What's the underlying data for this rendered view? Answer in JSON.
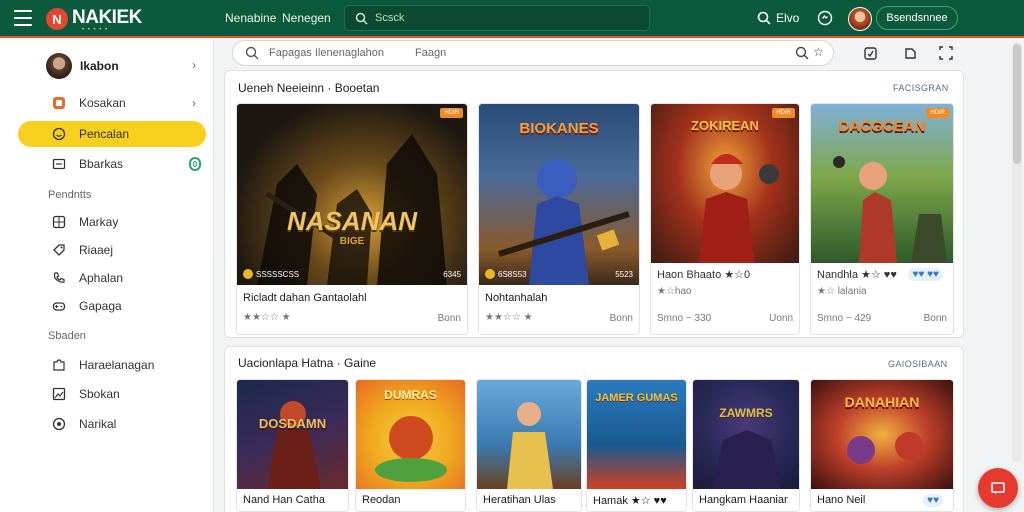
{
  "header": {
    "logo_letter": "N",
    "logo_text": "NAKIEK",
    "logo_sub": "• • • • •",
    "nav": [
      "Nenabine",
      "Nenegen"
    ],
    "search_placeholder": "Scsck",
    "right_label": "Elvo",
    "user_button": "Bsendsnnee"
  },
  "sidebar": {
    "profile_name": "Ikabon",
    "items_top": [
      {
        "label": "Kosakan",
        "icon": "orange-square-icon"
      },
      {
        "label": "Pencalan",
        "icon": "smile-icon"
      },
      {
        "label": "Bbarkas",
        "icon": "card-icon",
        "badge": "0"
      }
    ],
    "section1": "Pendntts",
    "items_mid": [
      {
        "label": "Markay",
        "icon": "grid-icon"
      },
      {
        "label": "Riaaej",
        "icon": "tag-icon"
      },
      {
        "label": "Aphalan",
        "icon": "phone-icon"
      },
      {
        "label": "Gapaga",
        "icon": "gamepad-icon"
      }
    ],
    "section2": "Sbaden",
    "items_bottom": [
      {
        "label": "Haraelanagan",
        "icon": "puzzle-icon"
      },
      {
        "label": "Sbokan",
        "icon": "image-icon"
      },
      {
        "label": "Narikal",
        "icon": "globe-icon"
      }
    ]
  },
  "main_search": {
    "placeholder": "Fapagas Ilenenaglahon",
    "placeholder2": "Faagn"
  },
  "section1": {
    "title": "Ueneh Neeieinn · Booetan",
    "link": "FACISGRAN",
    "cards": [
      {
        "art_title": "NASANAN",
        "art_sub": "BIGE",
        "tag": "HDIR",
        "coin_label": "SSSSSCSS",
        "count": "6345",
        "title": "Ricladt dahan Gantaolahl",
        "rating_text": "★★☆☆ ★",
        "meta": "Bonn",
        "palette": [
          "#1c1711",
          "#4d3a1e",
          "#d79e39"
        ]
      },
      {
        "art_title": "BIOKANES",
        "art_sub": "",
        "tag": "",
        "coin_label": "6S8S53",
        "count": "5523",
        "title": "Nohtanhalah",
        "rating_text": "★★☆☆ ★",
        "meta": "Bonn",
        "palette": [
          "#2a4a78",
          "#8a5a2c",
          "#e3a642"
        ]
      },
      {
        "art_title": "ZOKIREAN",
        "art_sub": "",
        "tag": "HDIR",
        "coin_label": "",
        "count": "",
        "title": "Haon Bhaato ★☆0",
        "rating_text": "★☆hao",
        "meta": "Smno ~ 330",
        "meta_r": "Uonn",
        "palette": [
          "#3a1a12",
          "#a4321c",
          "#f0a23a"
        ]
      },
      {
        "art_title": "DACGCEAN",
        "art_sub": "",
        "tag": "HDIR",
        "coin_label": "",
        "count": "",
        "title": "Nandhla ★☆ ♥♥",
        "chip": "♥♥ ♥♥",
        "rating_text": "★☆ lalania",
        "meta": "Smno ~ 429",
        "meta_r": "Bonn",
        "palette": [
          "#2d5a2a",
          "#7fa84a",
          "#e08a32"
        ]
      }
    ]
  },
  "section2": {
    "title": "Uacionlapa Hatna · Gaine",
    "link": "GAIOSIBAAN",
    "cards": [
      {
        "art_title": "DOSDAMN",
        "title": "Nand Han Catha",
        "palette": [
          "#1a2a4a",
          "#6a2a2a",
          "#e0c060"
        ]
      },
      {
        "art_title": "DUMRAS",
        "title": "Reodan",
        "palette": [
          "#f0a820",
          "#e86a20",
          "#50a040"
        ]
      },
      {
        "art_title": "",
        "title": "Heratihan Ulas",
        "palette": [
          "#3a7ab0",
          "#e8c050",
          "#6a4020"
        ]
      },
      {
        "art_title": "JAMER GUMAS",
        "title": "Hamak ★☆ ♥♥",
        "palette": [
          "#1a5a90",
          "#e8a830",
          "#d04020"
        ]
      },
      {
        "art_title": "ZAWMRS",
        "title": "Hangkam Haaniar",
        "palette": [
          "#1a1a3a",
          "#4a3a7a",
          "#c0a040"
        ]
      },
      {
        "art_title": "DANAHIAN",
        "title": "Hano Neil",
        "chip": "♥♥",
        "palette": [
          "#3a1010",
          "#c0402a",
          "#f0b040"
        ]
      }
    ]
  }
}
